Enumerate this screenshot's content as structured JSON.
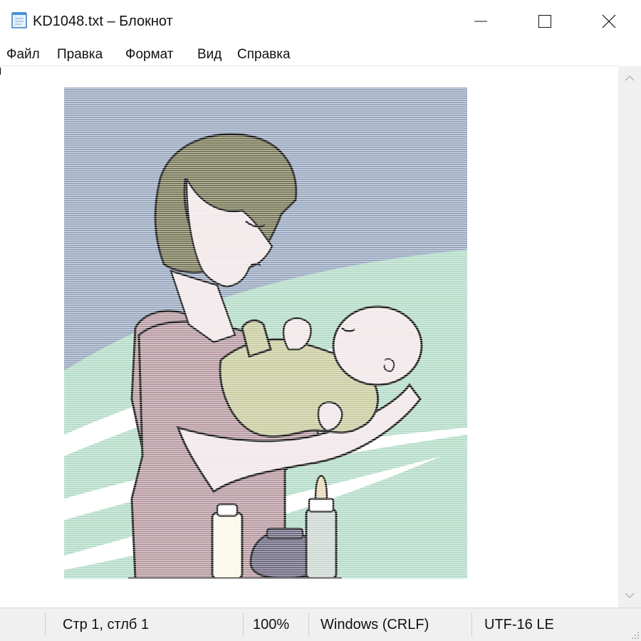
{
  "window": {
    "title": "KD1048.txt – Блокнот"
  },
  "menu": [
    "Файл",
    "Правка",
    "Формат",
    "Вид",
    "Справка"
  ],
  "editor": {
    "content_description_icon": "ascii-art-mother-with-baby"
  },
  "status": {
    "position": "Стр 1, стлб 1",
    "zoom": "100%",
    "line_endings": "Windows (CRLF)",
    "encoding": "UTF-16 LE"
  },
  "colors": {
    "sky": "#9aa9c0",
    "field": "#b4dcc8",
    "hair": "#7a7a5a",
    "dress": "#b89aa2",
    "skin": "#f1e6e8",
    "onesie": "#c9cc9f",
    "statusbar": "#f0f0f0"
  }
}
